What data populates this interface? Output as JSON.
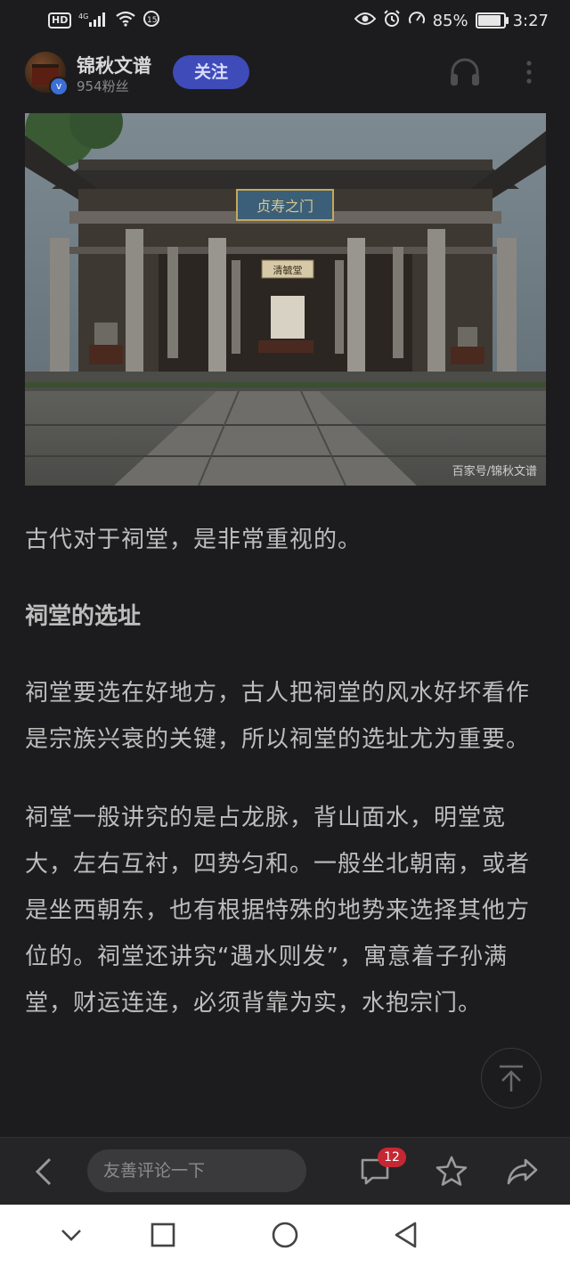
{
  "status_bar": {
    "hd": "HD",
    "signal": "4G",
    "battery_percent": "85%",
    "battery_level": 0.85,
    "time": "3:27"
  },
  "author": {
    "name": "锦秋文谱",
    "fans": "954粉丝",
    "follow_label": "关注"
  },
  "hero_image": {
    "watermark": "百家号/锦秋文谱",
    "plaque_top": "贞寿之门",
    "plaque_inner": "清毓堂"
  },
  "article": {
    "p1": "古代对于祠堂，是非常重视的。",
    "h1": "祠堂的选址",
    "p2": "祠堂要选在好地方，古人把祠堂的风水好坏看作是宗族兴衰的关键，所以祠堂的选址尤为重要。",
    "p3": "祠堂一般讲究的是占龙脉，背山面水，明堂宽大，左右互衬，四势匀和。一般坐北朝南，或者是坐西朝东，也有根据特殊的地势来选择其他方位的。祠堂还讲究“遇水则发”，寓意着子孙满堂，财运连连，必须背靠为实，水抱宗门。"
  },
  "bottom_bar": {
    "comment_placeholder": "友善评论一下",
    "comment_count": "12"
  },
  "colors": {
    "background": "#1c1c1e",
    "follow_button": "#3e4bb8",
    "badge": "#c62833"
  }
}
